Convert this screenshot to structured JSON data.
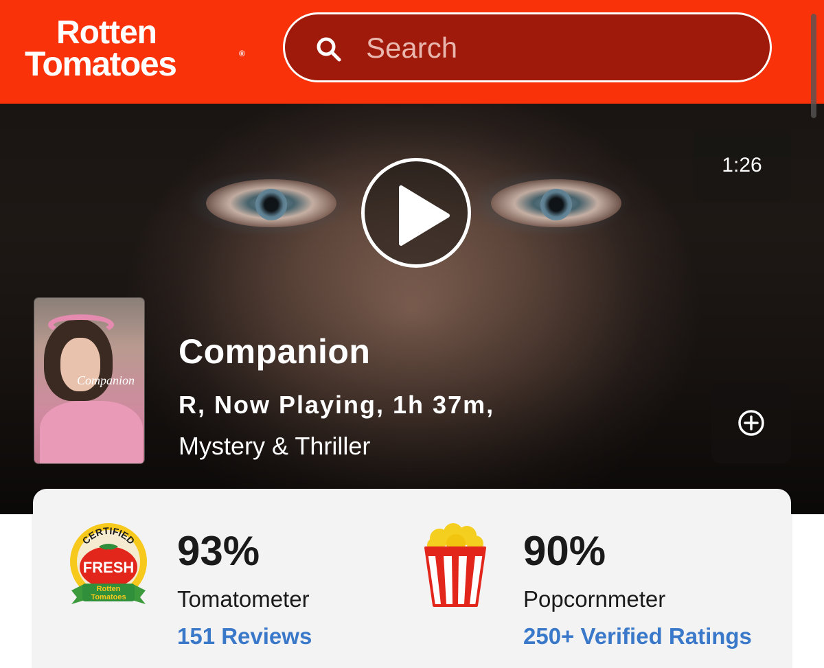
{
  "header": {
    "logo_line1": "Rotten",
    "logo_line2": "Tomatoes",
    "logo_reg": "®",
    "search_placeholder": "Search",
    "search_icon": "search-icon"
  },
  "hero": {
    "duration": "1:26",
    "play_icon": "play-icon",
    "add_icon": "add-circle-icon"
  },
  "movie": {
    "title": "Companion",
    "poster_title": "Companion",
    "meta": "R, Now Playing, 1h 37m,",
    "genre": "Mystery & Thriller"
  },
  "scores": {
    "tomatometer": {
      "value": "93%",
      "label": "Tomatometer",
      "reviews": "151 Reviews",
      "badge": {
        "top": "CERTIFIED",
        "middle": "FRESH",
        "bottom_line1": "Rotten",
        "bottom_line2": "Tomatoes"
      }
    },
    "popcornmeter": {
      "value": "90%",
      "label": "Popcornmeter",
      "ratings": "250+ Verified Ratings"
    }
  },
  "colors": {
    "brand_red": "#fa320a",
    "search_bg": "#9f1a0a",
    "link_blue": "#3a78c9",
    "card_bg": "#f3f3f3"
  }
}
